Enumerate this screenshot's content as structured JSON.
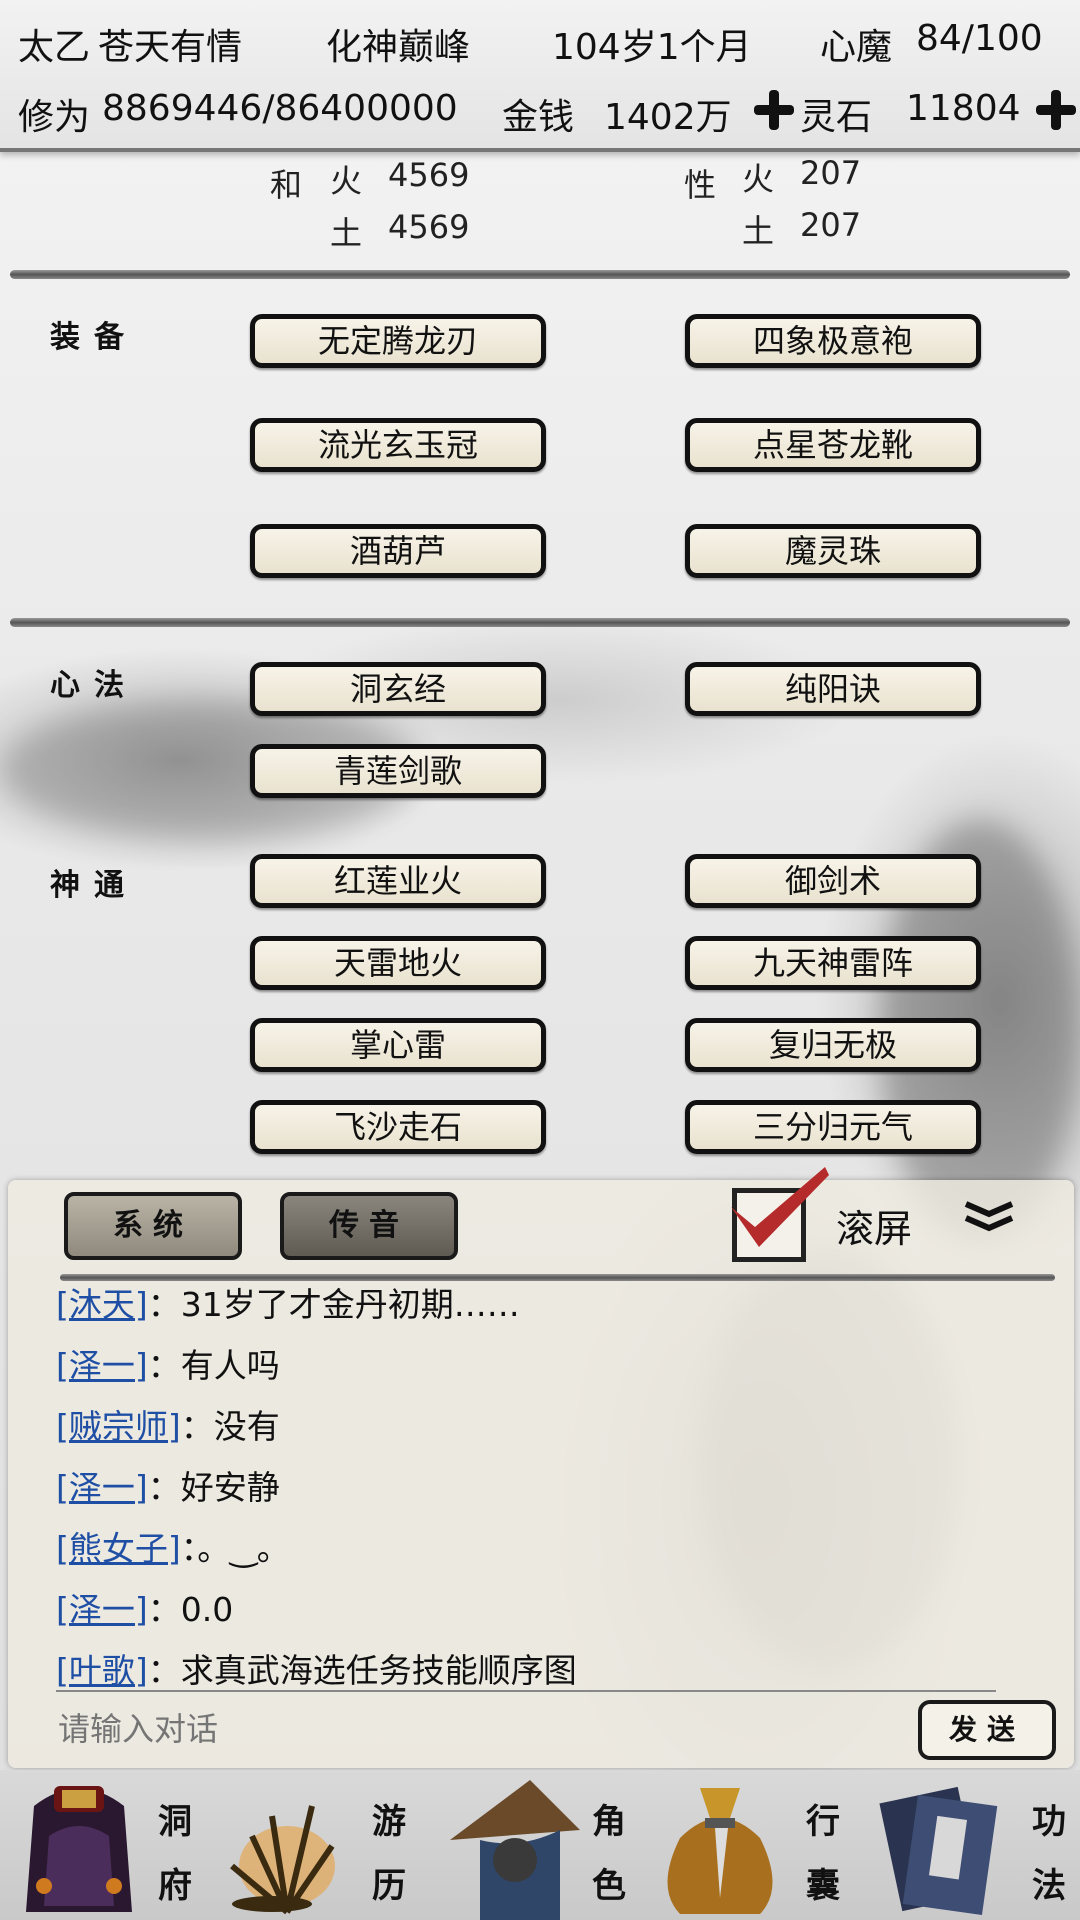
{
  "header": {
    "sect": "太乙",
    "name": "苍天有情",
    "realm": "化神巅峰",
    "age": "104岁1个月",
    "demon_label": "心魔",
    "demon_value": "84/100",
    "cultivation_label": "修为",
    "cultivation_value": "8869446/86400000",
    "money_label": "金钱",
    "money_value": "1402万",
    "stone_label": "灵石",
    "stone_value": "11804"
  },
  "stats": {
    "left_label_top": "和",
    "left_fire_label": "火",
    "left_fire_value": "4569",
    "left_earth_label": "土",
    "left_earth_value": "4569",
    "right_label_top": "性",
    "right_fire_label": "火",
    "right_fire_value": "207",
    "right_earth_label": "土",
    "right_earth_value": "207"
  },
  "equipment": {
    "label": "装备",
    "items": [
      "无定腾龙刃",
      "四象极意袍",
      "流光玄玉冠",
      "点星苍龙靴",
      "酒葫芦",
      "魔灵珠"
    ]
  },
  "heart_methods": {
    "label": "心法",
    "items": [
      "洞玄经",
      "纯阳诀",
      "青莲剑歌"
    ]
  },
  "abilities": {
    "label": "神通",
    "items": [
      "红莲业火",
      "御剑术",
      "天雷地火",
      "九天神雷阵",
      "掌心雷",
      "复归无极",
      "飞沙走石",
      "三分归元气"
    ]
  },
  "chat": {
    "tab_system": "系统",
    "tab_whisper": "传音",
    "scroll_label": "滚屏",
    "scroll_checked": true,
    "messages": [
      {
        "who": "[沐天]",
        "text": "：31岁了才金丹初期……"
      },
      {
        "who": "[泽一]",
        "text": "：有人吗"
      },
      {
        "who": "[贼宗师]",
        "text": "：没有"
      },
      {
        "who": "[泽一]",
        "text": "：好安静"
      },
      {
        "who": "[熊女子]",
        "text": "：。‿。"
      },
      {
        "who": "[泽一]",
        "text": "：0.0"
      },
      {
        "who": "[叶歌]",
        "text": "：求真武海选任务技能顺序图"
      }
    ],
    "input_placeholder": "请输入对话",
    "send_label": "发送"
  },
  "nav": {
    "items": [
      {
        "l1": "洞",
        "l2": "府"
      },
      {
        "l1": "游",
        "l2": "历"
      },
      {
        "l1": "角",
        "l2": "色"
      },
      {
        "l1": "行",
        "l2": "囊"
      },
      {
        "l1": "功",
        "l2": "法"
      }
    ]
  },
  "colors": {
    "link": "#1f4fa5",
    "check": "#b52a2a",
    "button_bg": "#efe9d8"
  }
}
